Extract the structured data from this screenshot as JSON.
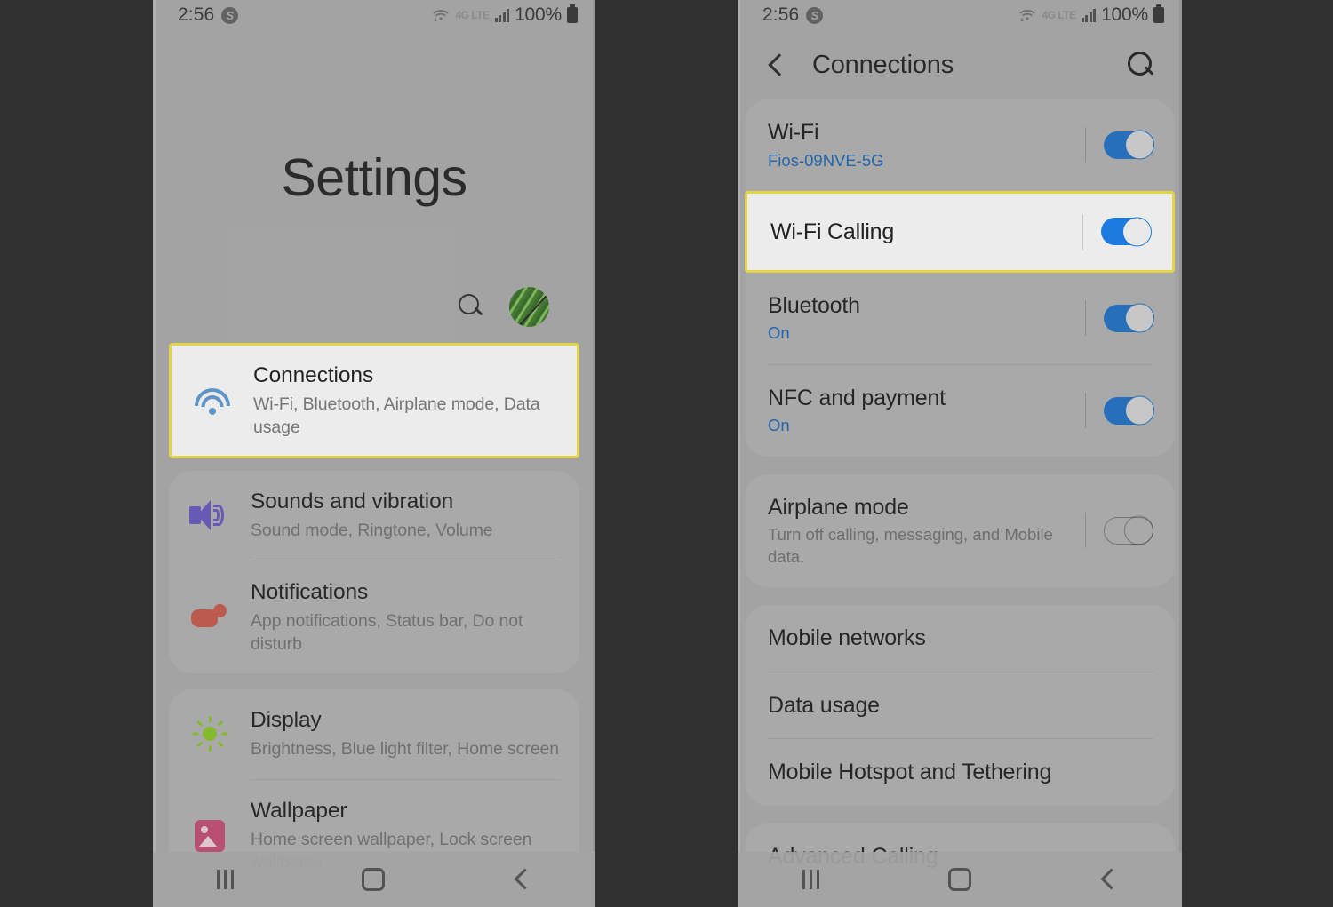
{
  "status_bar": {
    "time": "2:56",
    "shazam_icon": "shazam-icon",
    "wifi_icon": "wifi-transfer-icon",
    "network_type": "4G LTE",
    "signal_icon": "signal-bars-icon",
    "battery_percent": "100%",
    "battery_icon": "battery-full-icon"
  },
  "colors": {
    "background": "#252525",
    "screen": "#ababab",
    "highlight_border": "#f5e63d",
    "highlight_fill": "#ffffff",
    "toggle_on": "#1a6fc4",
    "toggle_on_bright": "#0c7cf0",
    "link_blue": "#1464b4",
    "wifi_icon_blue": "#5b9bd5",
    "sound_icon_purple": "#6355c0",
    "notification_icon_red": "#c95548",
    "display_icon_green": "#88c422",
    "wallpaper_icon_pink": "#c24a72"
  },
  "left_screen": {
    "title": "Settings",
    "search_icon": "search-icon",
    "avatar": "profile-avatar",
    "groups": [
      {
        "highlighted": true,
        "items": [
          {
            "icon": "wifi-icon",
            "title": "Connections",
            "subtitle": "Wi-Fi, Bluetooth, Airplane mode, Data usage"
          }
        ]
      },
      {
        "highlighted": false,
        "items": [
          {
            "icon": "speaker-icon",
            "title": "Sounds and vibration",
            "subtitle": "Sound mode, Ringtone, Volume"
          },
          {
            "icon": "notification-icon",
            "title": "Notifications",
            "subtitle": "App notifications, Status bar, Do not disturb"
          }
        ]
      },
      {
        "highlighted": false,
        "items": [
          {
            "icon": "brightness-icon",
            "title": "Display",
            "subtitle": "Brightness, Blue light filter, Home screen"
          },
          {
            "icon": "wallpaper-icon",
            "title": "Wallpaper",
            "subtitle": "Home screen wallpaper, Lock screen wallpaper"
          }
        ]
      }
    ]
  },
  "right_screen": {
    "back_icon": "back-chevron-icon",
    "title": "Connections",
    "search_icon": "search-icon",
    "group1": {
      "wifi": {
        "title": "Wi-Fi",
        "subtitle": "Fios-09NVE-5G",
        "toggle": "on"
      },
      "wifi_calling": {
        "title": "Wi-Fi Calling",
        "subtitle": "",
        "toggle": "on",
        "highlighted": true
      },
      "bluetooth": {
        "title": "Bluetooth",
        "subtitle": "On",
        "toggle": "on"
      },
      "nfc": {
        "title": "NFC and payment",
        "subtitle": "On",
        "toggle": "on"
      }
    },
    "group2": {
      "airplane": {
        "title": "Airplane mode",
        "subtitle": "Turn off calling, messaging, and Mobile data.",
        "toggle": "off"
      }
    },
    "group3": {
      "items": [
        {
          "title": "Mobile networks"
        },
        {
          "title": "Data usage"
        },
        {
          "title": "Mobile Hotspot and Tethering"
        }
      ]
    },
    "group4": {
      "items": [
        {
          "title": "Advanced Calling"
        }
      ]
    }
  },
  "nav_bar": {
    "recents_icon": "recents-icon",
    "home_icon": "home-icon",
    "back_icon": "back-icon"
  }
}
